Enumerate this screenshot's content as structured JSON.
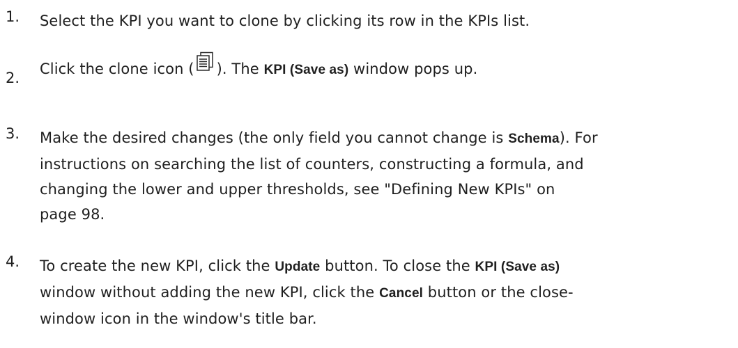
{
  "steps": [
    {
      "number": "1.",
      "text": "Select the KPI you want to clone by clicking its row in the KPIs list."
    },
    {
      "number": "2.",
      "pre_icon": "Click the clone icon (",
      "icon": "clone-icon",
      "post_icon": "). The ",
      "bold1": "KPI (Save as)",
      "tail": " window pops up."
    },
    {
      "number": "3.",
      "pre": "Make the desired changes (the only field you cannot change is ",
      "bold1": "Schema",
      "line1_end": "). For",
      "line2": "instructions on searching the list of counters, constructing a formula, and",
      "line3": "changing the lower and upper thresholds, see \"Defining New KPIs\" on",
      "line4": "page 98."
    },
    {
      "number": "4.",
      "pre": "To create the new KPI, click the ",
      "bold1": "Update",
      "mid1": " button. To close the ",
      "bold2": "KPI (Save as)",
      "line2_pre": "window without adding the new KPI, click the ",
      "bold3": "Cancel",
      "line2_post": " button or the close-",
      "line3": "window icon in the window's title bar."
    }
  ]
}
